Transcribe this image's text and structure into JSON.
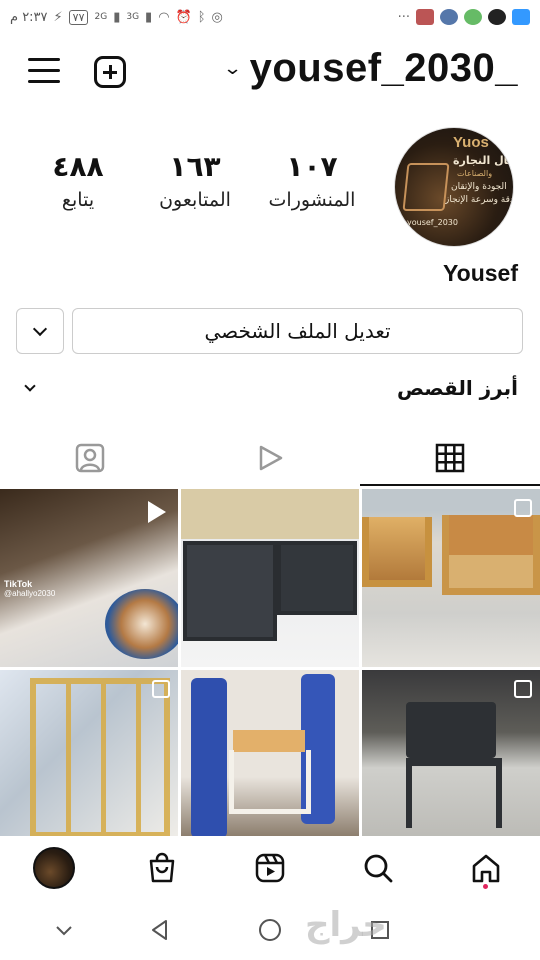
{
  "status_bar": {
    "time": "٢:٣٧ م",
    "battery": "٧٧",
    "network_1": "2G",
    "network_2": "3G",
    "icons": [
      "whatsapp-icon",
      "alarm-icon",
      "bluetooth-icon",
      "wifi-icon",
      "signal-icon",
      "charging-icon",
      "more-icon",
      "notification-icons"
    ]
  },
  "header": {
    "username": "yousef_2030_",
    "menu_icon": "hamburger-icon",
    "new_post_icon": "plus-square-icon",
    "account_switch_icon": "chevron-down-icon"
  },
  "profile": {
    "display_name": "Yousef",
    "avatar_text": {
      "brand": "Yuos",
      "line1": "أعمال النجارة",
      "line2": "والصناعات",
      "line3": "الجودة والإتقان",
      "line4": "الدقة وسرعة الإنجاز",
      "handle": "yousef_2030"
    },
    "stats": {
      "posts": {
        "value": "١٠٧",
        "label": "المنشورات"
      },
      "followers": {
        "value": "١٦٣",
        "label": "المتابعون"
      },
      "following": {
        "value": "٤٨٨",
        "label": "يتابع"
      }
    },
    "edit_button": "تعديل الملف الشخصي"
  },
  "highlights": {
    "label": "أبرز القصص"
  },
  "tabs": [
    {
      "name": "grid",
      "icon": "grid-icon",
      "active": true
    },
    {
      "name": "reels",
      "icon": "play-icon",
      "active": false
    },
    {
      "name": "tagged",
      "icon": "tagged-person-icon",
      "active": false
    }
  ],
  "posts": [
    {
      "kind": "reel",
      "desc": "coffee cup",
      "tiktok_label": "TikTok",
      "tiktok_handle": "@ahallyo2030"
    },
    {
      "kind": "image",
      "desc": "gray shelving unit"
    },
    {
      "kind": "carousel",
      "desc": "wooden benches"
    },
    {
      "kind": "carousel",
      "desc": "wooden cabinet frames"
    },
    {
      "kind": "image",
      "desc": "playground slide and chair"
    },
    {
      "kind": "carousel",
      "desc": "black chair"
    }
  ],
  "bottom_nav": {
    "items": [
      "home-icon",
      "search-icon",
      "reels-icon",
      "shop-icon",
      "profile-avatar"
    ]
  },
  "system_nav": {
    "items": [
      "recents-square-icon",
      "home-circle-icon",
      "back-triangle-icon",
      "chevron-down-icon"
    ]
  },
  "watermark": "حراج",
  "colors": {
    "accent": "#111111",
    "notification_dot": "#e0245e",
    "button_border": "#cccccc"
  }
}
